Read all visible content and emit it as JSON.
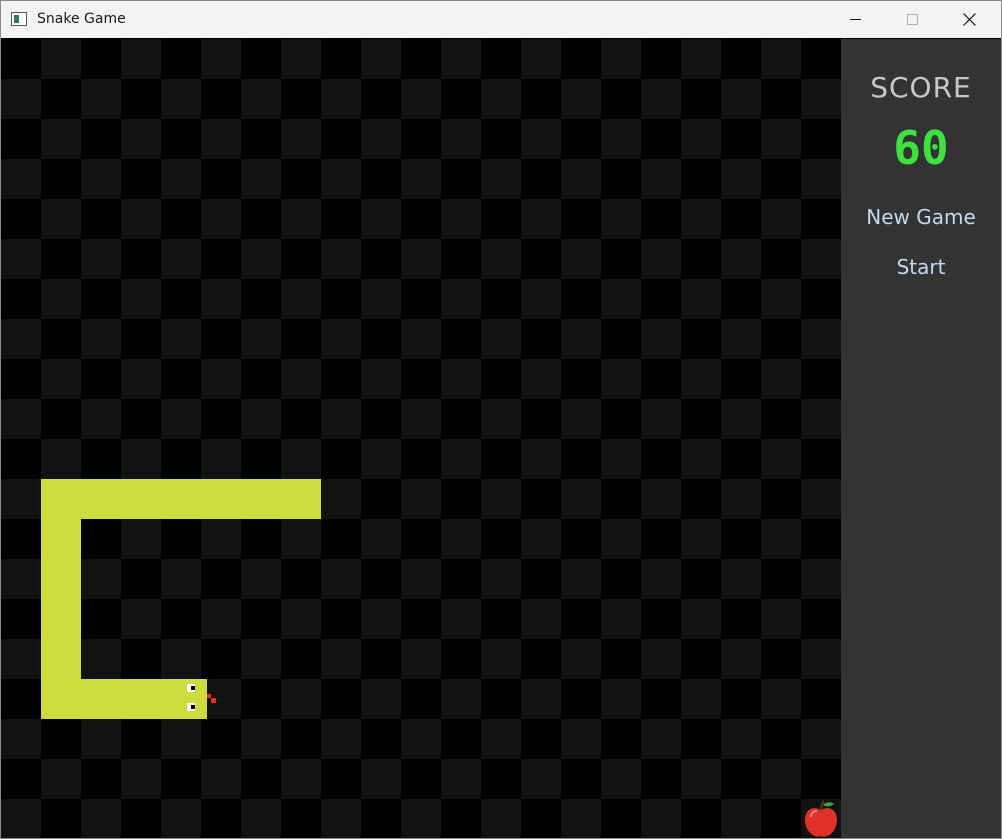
{
  "window": {
    "title": "Snake Game",
    "app_icon": "window-app-icon",
    "controls": [
      "minimize-icon",
      "maximize-icon",
      "close-icon"
    ]
  },
  "panel": {
    "score_label": "SCORE",
    "score_value": "60",
    "new_game_label": "New Game",
    "start_label": "Start"
  },
  "colors": {
    "board_dark": "#000000",
    "board_light": "#111111",
    "snake": "#cedb3d",
    "panel_bg": "#333333",
    "score_value": "#3ee23e",
    "score_label": "#c8c8c8",
    "button_text": "#c6d8f0",
    "apple": "#e0302a"
  },
  "game": {
    "snake_direction": "right",
    "food": "apple-icon"
  }
}
